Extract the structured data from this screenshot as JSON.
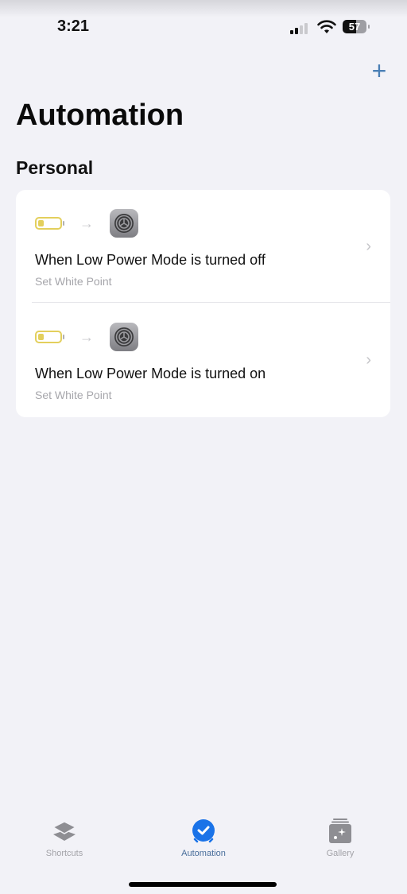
{
  "status_bar": {
    "time": "3:21",
    "signal_bars_active": 2,
    "signal_bars_total": 4,
    "battery_percent": "57"
  },
  "header": {
    "add_button_label": "+",
    "title": "Automation"
  },
  "section": {
    "title": "Personal"
  },
  "automations": [
    {
      "trigger_icon": "low-battery-icon",
      "action_icon": "settings-icon",
      "title": "When Low Power Mode is turned off",
      "subtitle": "Set White Point"
    },
    {
      "trigger_icon": "low-battery-icon",
      "action_icon": "settings-icon",
      "title": "When Low Power Mode is turned on",
      "subtitle": "Set White Point"
    }
  ],
  "tab_bar": {
    "tabs": [
      {
        "label": "Shortcuts",
        "icon": "layers-icon",
        "active": false
      },
      {
        "label": "Automation",
        "icon": "clock-check-icon",
        "active": true
      },
      {
        "label": "Gallery",
        "icon": "gallery-icon",
        "active": false
      }
    ]
  },
  "colors": {
    "accent": "#1a73e8",
    "background": "#f2f2f7",
    "battery_low": "#e3cf5c"
  }
}
